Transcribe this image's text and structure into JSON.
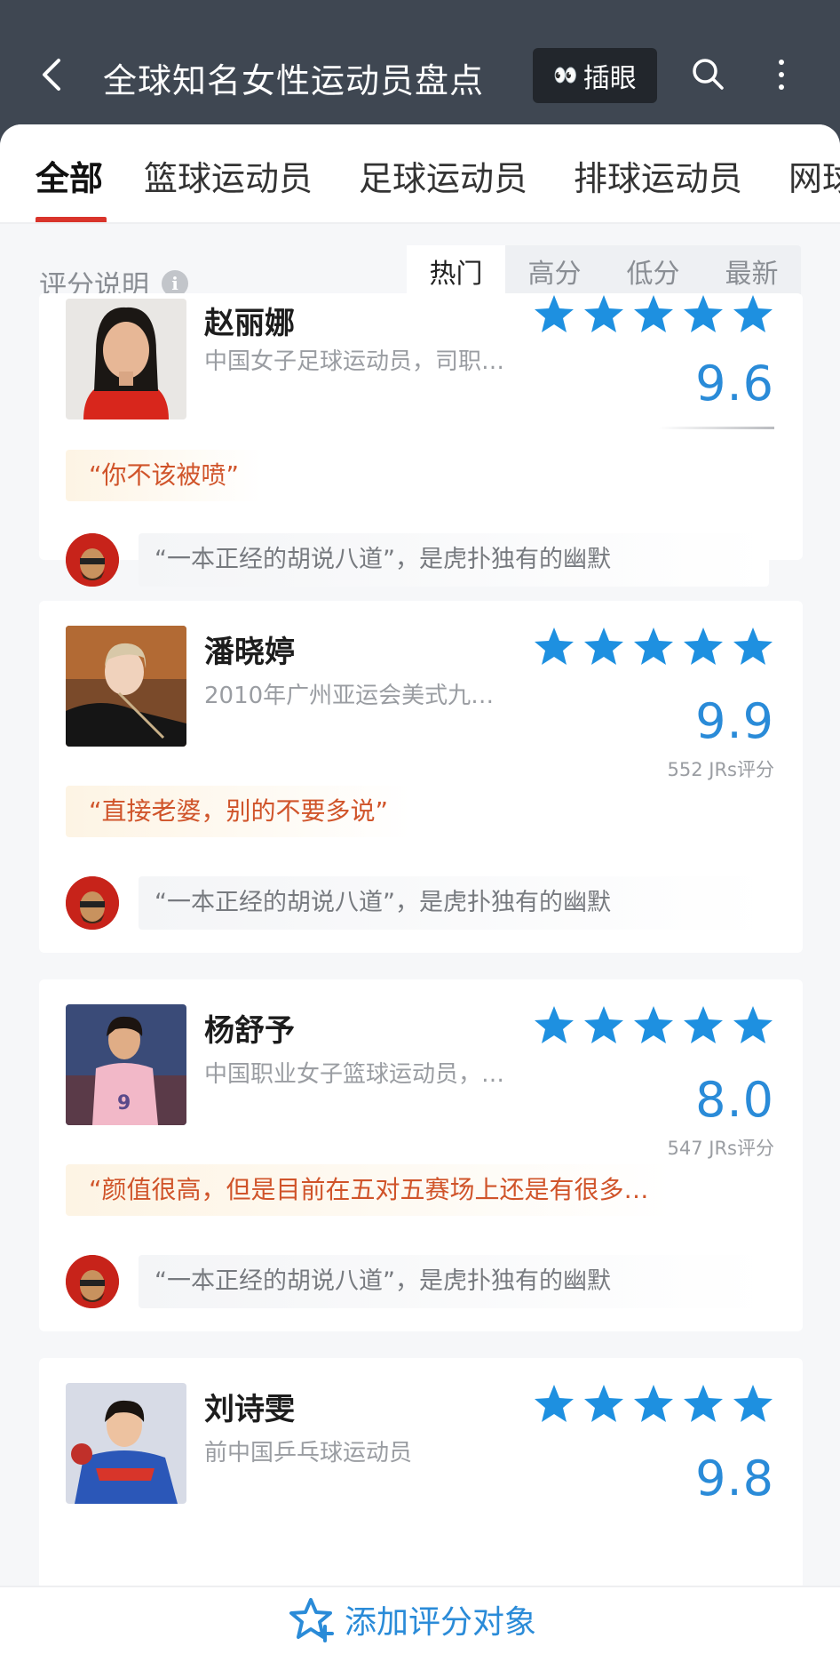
{
  "header": {
    "title": "全球知名女性运动员盘点",
    "peek_label": "插眼",
    "back_icon": "chevron-left-icon",
    "search_icon": "search-icon",
    "more_icon": "more-vertical-icon"
  },
  "tabs": [
    {
      "label": "全部",
      "active": true
    },
    {
      "label": "篮球运动员",
      "active": false
    },
    {
      "label": "足球运动员",
      "active": false
    },
    {
      "label": "排球运动员",
      "active": false
    },
    {
      "label": "网球",
      "active": false
    }
  ],
  "sortbar": {
    "explain_label": "评分说明",
    "info_icon": "info-icon",
    "sorts": [
      {
        "label": "热门",
        "active": true
      },
      {
        "label": "高分",
        "active": false
      },
      {
        "label": "低分",
        "active": false
      },
      {
        "label": "最新",
        "active": false
      }
    ]
  },
  "colors": {
    "accent_red": "#d9342b",
    "score_blue": "#2a8bd8",
    "star_blue": "#1e90e0",
    "quote_orange": "#d0542a",
    "header_bg": "#3f4752"
  },
  "athletes": [
    {
      "name": "赵丽娜",
      "desc": "中国女子足球运动员，司职…",
      "stars": 5,
      "score": "9.6",
      "votes": "",
      "quote": "“你不该被喷”",
      "comment": "“一本正经的胡说八道”，是虎扑独有的幽默"
    },
    {
      "name": "潘晓婷",
      "desc": "2010年广州亚运会美式九…",
      "stars": 5,
      "score": "9.9",
      "votes": "552 JRs评分",
      "quote": "“直接老婆，别的不要多说”",
      "comment": "“一本正经的胡说八道”，是虎扑独有的幽默"
    },
    {
      "name": "杨舒予",
      "desc": "中国职业女子篮球运动员，…",
      "stars": 5,
      "score": "8.0",
      "votes": "547 JRs评分",
      "quote": "“颜值很高，但是目前在五对五赛场上还是有很多…",
      "comment": "“一本正经的胡说八道”，是虎扑独有的幽默"
    },
    {
      "name": "刘诗雯",
      "desc": "前中国乒乓球运动员",
      "stars": 5,
      "score": "9.8",
      "votes": "",
      "quote": "",
      "comment": ""
    }
  ],
  "footer": {
    "add_label": "添加评分对象",
    "add_icon": "star-plus-icon"
  }
}
